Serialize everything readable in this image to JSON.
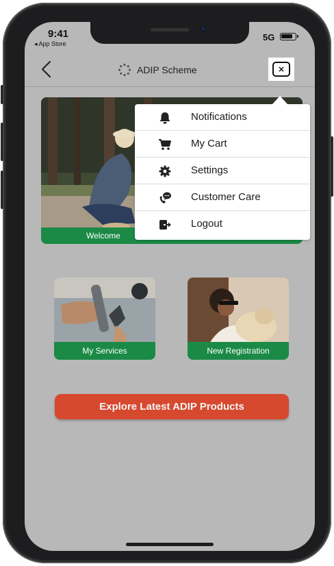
{
  "status_bar": {
    "time": "9:41",
    "back_app": "◂ App Store",
    "signal": "5G"
  },
  "header": {
    "title": "ADIP Scheme",
    "close_symbol": "×"
  },
  "hero": {
    "caption": "Welcome"
  },
  "cards": [
    {
      "caption": "My Services"
    },
    {
      "caption": "New Registration"
    }
  ],
  "explore_button": {
    "label": "Explore Latest ADIP Products"
  },
  "menu": {
    "items": [
      {
        "label": "Notifications",
        "icon": "bell-icon"
      },
      {
        "label": "My Cart",
        "icon": "cart-icon"
      },
      {
        "label": "Settings",
        "icon": "gear-icon"
      },
      {
        "label": "Customer Care",
        "icon": "chat-phone-icon"
      },
      {
        "label": "Logout",
        "icon": "logout-icon"
      }
    ]
  },
  "colors": {
    "accent_green": "#1b8a46",
    "cta_red": "#d6492f",
    "screen_bg": "#b8b8b8"
  }
}
